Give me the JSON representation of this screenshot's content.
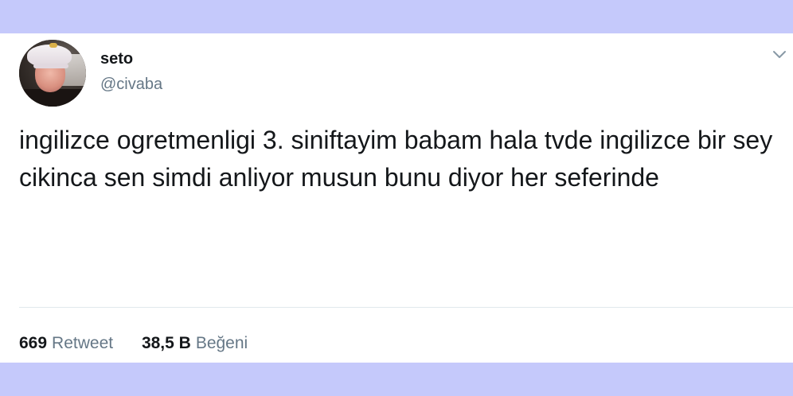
{
  "tweet": {
    "user": {
      "name": "seto",
      "handle": "@civaba",
      "avatar": "profile-photo"
    },
    "text": "ingilizce ogretmenligi 3. siniftayim babam hala tvde ingilizce bir sey cikinca sen simdi anliyor musun bunu diyor her seferinde",
    "menu_icon": "chevron-down-icon",
    "stats": {
      "retweets_count": "669",
      "retweets_label": "Retweet",
      "likes_count": "38,5 B",
      "likes_label": "Beğeni"
    }
  },
  "colors": {
    "background": "#c5c9fb",
    "card": "#ffffff",
    "text_primary": "#14171a",
    "text_secondary": "#657786",
    "divider": "#e1e8ed"
  }
}
